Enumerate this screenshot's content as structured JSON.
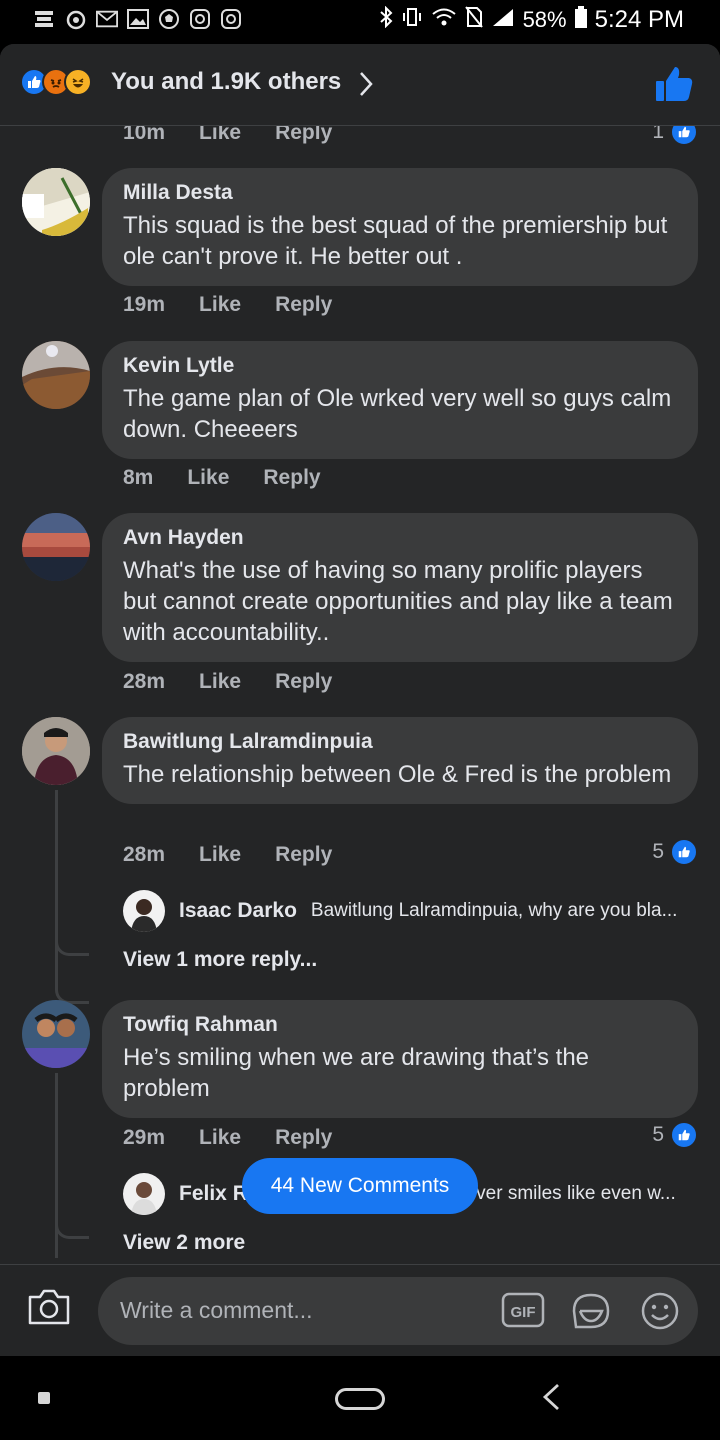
{
  "status_bar": {
    "battery": "58%",
    "time": "5:24 PM",
    "left_icons": [
      "premier-league-icon",
      "pig-icon",
      "gmail-icon",
      "gallery-icon",
      "football-icon",
      "instagram-icon",
      "instagram-icon"
    ],
    "right_icons": [
      "bluetooth-icon",
      "vibrate-icon",
      "wifi-icon",
      "no-sim-icon",
      "signal-icon",
      "battery-icon"
    ]
  },
  "header": {
    "reactions_summary": "You and 1.9K others",
    "reaction_icons": [
      "like",
      "angry",
      "haha"
    ]
  },
  "top_partial": {
    "time": "10m",
    "like": "Like",
    "reply": "Reply",
    "likes": "1"
  },
  "comments": [
    {
      "name": "Milla Desta",
      "text": "This squad is the best squad of the premiership but ole can't prove it. He better out .",
      "time": "19m",
      "like": "Like",
      "reply": "Reply"
    },
    {
      "name": "Kevin Lytle",
      "text": "The game plan of Ole wrked very well so guys calm down. Cheeeers",
      "time": "8m",
      "like": "Like",
      "reply": "Reply"
    },
    {
      "name": "Avn Hayden",
      "text": "What's the use of having so many prolific players but cannot create opportunities and play like a team with accountability..",
      "time": "28m",
      "like": "Like",
      "reply": "Reply"
    },
    {
      "name": "Bawitlung Lalramdinpuia",
      "text": "The relationship between Ole & Fred is the problem",
      "time": "28m",
      "like": "Like",
      "reply": "Reply",
      "likes": "5",
      "reply_preview": {
        "name": "Isaac Darko",
        "text": "Bawitlung Lalramdinpuia, why are you bla..."
      },
      "view_more": "View 1 more reply..."
    },
    {
      "name": "Towfiq Rahman",
      "text": "He’s smiling when we are drawing that’s the problem",
      "time": "29m",
      "like": "Like",
      "reply": "Reply",
      "likes": "5",
      "reply_preview": {
        "name": "Felix Ruto",
        "text": "Towfiq Rahman Ole ever smiles like even w..."
      },
      "view_more": "View 2 more"
    }
  ],
  "new_comments_button": "44 New Comments",
  "composer": {
    "placeholder": "Write a comment...",
    "gif_label": "GIF"
  },
  "colors": {
    "background": "#242526",
    "bubble": "#3a3b3c",
    "accent": "#1877f2",
    "text": "#e4e6eb",
    "muted": "#b0b3b8"
  }
}
